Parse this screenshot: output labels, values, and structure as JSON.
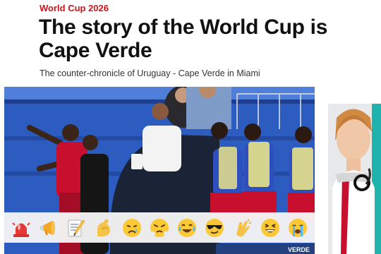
{
  "article": {
    "kicker": "World Cup 2026",
    "headline": "The story of the World Cup is Cape Verde",
    "subheading": "The counter-chronicle of Uruguay - Cape Verde in Miami",
    "photo_ad_text": "VERDE"
  },
  "reactions": [
    {
      "name": "siren",
      "icon": "siren-icon"
    },
    {
      "name": "megaphone",
      "icon": "megaphone-icon"
    },
    {
      "name": "memo",
      "icon": "memo-icon"
    },
    {
      "name": "flexed-biceps",
      "icon": "flexed-biceps-icon"
    },
    {
      "name": "crying-face",
      "icon": "crying-face-icon"
    },
    {
      "name": "steam-face",
      "icon": "steam-face-icon"
    },
    {
      "name": "tears-of-joy",
      "icon": "tears-of-joy-icon"
    },
    {
      "name": "sunglasses-face",
      "icon": "sunglasses-face-icon"
    },
    {
      "name": "clapping-hands",
      "icon": "clapping-hands-icon"
    },
    {
      "name": "grinning-squint",
      "icon": "grinning-squint-icon"
    },
    {
      "name": "loudly-crying",
      "icon": "loudly-crying-icon"
    }
  ],
  "colors": {
    "kicker": "#d0141a",
    "ad_teal": "#1fb3ad",
    "kit_red": "#c8102e"
  }
}
